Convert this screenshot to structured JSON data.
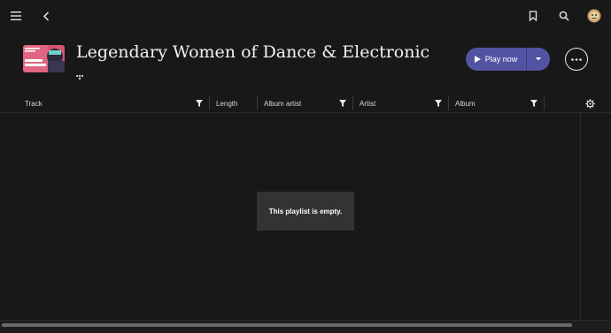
{
  "colors": {
    "background": "#181818",
    "accent": "#5254a3",
    "empty_box": "#333333"
  },
  "topbar": {
    "icons": [
      "menu-icon",
      "back-icon",
      "bookmark-icon",
      "search-icon",
      "user-avatar"
    ]
  },
  "playlist": {
    "title": "Legendary Women of Dance & Electronic",
    "cover_text_top": "LEGENDARY WOMEN OF",
    "cover_text_bottom": "DANCE & ELECTRONIC",
    "source_icon": "tidal-icon"
  },
  "actions": {
    "play_label": "Play now",
    "dropdown_icon": "caret-down-icon",
    "more_icon": "more-icon"
  },
  "columns": [
    {
      "label": "Track",
      "filter": true
    },
    {
      "label": "Length",
      "filter": false
    },
    {
      "label": "Album artist",
      "filter": true
    },
    {
      "label": "Artist",
      "filter": true
    },
    {
      "label": "Album",
      "filter": true
    }
  ],
  "empty_message": "This playlist is empty."
}
